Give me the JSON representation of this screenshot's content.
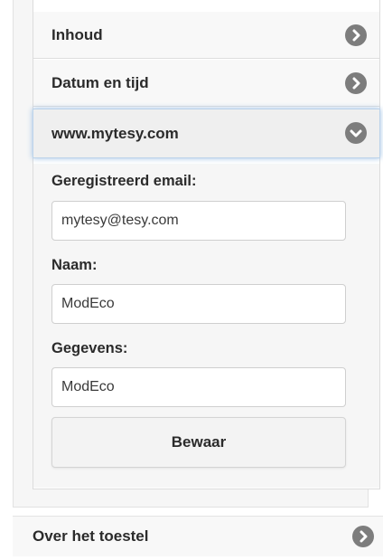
{
  "menu": {
    "items": [
      {
        "label": "Inhoud",
        "icon": "chevron-right-icon"
      },
      {
        "label": "Datum en tijd",
        "icon": "chevron-right-icon"
      },
      {
        "label": "www.mytesy.com",
        "icon": "chevron-down-icon"
      }
    ]
  },
  "form": {
    "email_label": "Geregistreerd email:",
    "email_value": "mytesy@tesy.com",
    "name_label": "Naam:",
    "name_value": "ModEco",
    "details_label": "Gegevens:",
    "details_value": "ModEco",
    "save_label": "Bewaar"
  },
  "bottom": {
    "label": "Over het toestel",
    "icon": "chevron-right-icon"
  },
  "colors": {
    "chevron": "#7d7d7d",
    "active_border": "#9fc0e3"
  }
}
